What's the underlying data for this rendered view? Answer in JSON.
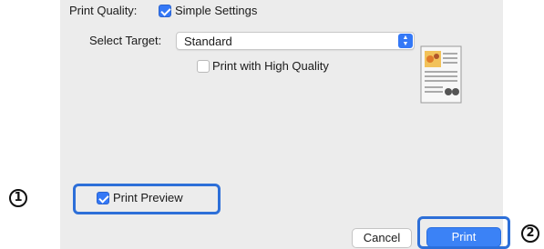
{
  "dialog": {
    "print_quality_label": "Print Quality:",
    "simple_settings_label": "Simple Settings",
    "simple_settings_checked": true,
    "select_target_label": "Select Target:",
    "select_target_value": "Standard",
    "high_quality_label": "Print with High Quality",
    "high_quality_checked": false,
    "print_preview_label": "Print Preview",
    "print_preview_checked": true,
    "cancel_label": "Cancel",
    "print_label": "Print"
  },
  "callouts": {
    "one": "1",
    "two": "2"
  },
  "colors": {
    "accent": "#3478f6",
    "highlight_border": "#2d6fd8",
    "dialog_bg": "#ececec"
  }
}
